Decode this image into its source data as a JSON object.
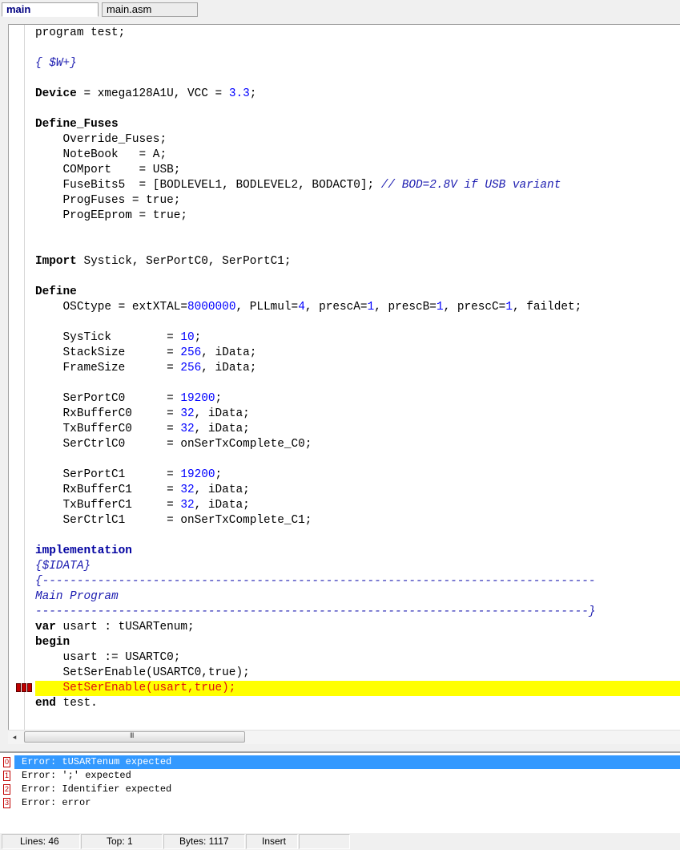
{
  "tabs": [
    {
      "label": "main",
      "active": true
    },
    {
      "label": "main.asm",
      "active": false
    }
  ],
  "code_lines": [
    [
      {
        "t": "program test;"
      }
    ],
    [],
    [
      {
        "t": "{ $W+}",
        "c": "cm"
      }
    ],
    [],
    [
      {
        "t": "Device",
        "c": "kw"
      },
      {
        "t": " = xmega128A1U, VCC = "
      },
      {
        "t": "3.3",
        "c": "num"
      },
      {
        "t": ";"
      }
    ],
    [],
    [
      {
        "t": "Define_Fuses",
        "c": "kw"
      }
    ],
    [
      {
        "t": "    Override_Fuses;"
      }
    ],
    [
      {
        "t": "    NoteBook   = A;"
      }
    ],
    [
      {
        "t": "    COMport    = USB;"
      }
    ],
    [
      {
        "t": "    FuseBits5  = [BODLEVEL1, BODLEVEL2, BODACT0]; "
      },
      {
        "t": "// BOD=2.8V if USB variant",
        "c": "cm"
      }
    ],
    [
      {
        "t": "    ProgFuses = true;"
      }
    ],
    [
      {
        "t": "    ProgEEprom = true;"
      }
    ],
    [],
    [],
    [
      {
        "t": "Import",
        "c": "kw"
      },
      {
        "t": " Systick, SerPortC0, SerPortC1;"
      }
    ],
    [],
    [
      {
        "t": "Define",
        "c": "kw"
      }
    ],
    [
      {
        "t": "    OSCtype = extXTAL="
      },
      {
        "t": "8000000",
        "c": "num"
      },
      {
        "t": ", PLLmul="
      },
      {
        "t": "4",
        "c": "num"
      },
      {
        "t": ", prescA="
      },
      {
        "t": "1",
        "c": "num"
      },
      {
        "t": ", prescB="
      },
      {
        "t": "1",
        "c": "num"
      },
      {
        "t": ", prescC="
      },
      {
        "t": "1",
        "c": "num"
      },
      {
        "t": ", faildet;"
      }
    ],
    [],
    [
      {
        "t": "    SysTick        = "
      },
      {
        "t": "10",
        "c": "num"
      },
      {
        "t": ";"
      }
    ],
    [
      {
        "t": "    StackSize      = "
      },
      {
        "t": "256",
        "c": "num"
      },
      {
        "t": ", iData;"
      }
    ],
    [
      {
        "t": "    FrameSize      = "
      },
      {
        "t": "256",
        "c": "num"
      },
      {
        "t": ", iData;"
      }
    ],
    [],
    [
      {
        "t": "    SerPortC0      = "
      },
      {
        "t": "19200",
        "c": "num"
      },
      {
        "t": ";"
      }
    ],
    [
      {
        "t": "    RxBufferC0     = "
      },
      {
        "t": "32",
        "c": "num"
      },
      {
        "t": ", iData;"
      }
    ],
    [
      {
        "t": "    TxBufferC0     = "
      },
      {
        "t": "32",
        "c": "num"
      },
      {
        "t": ", iData;"
      }
    ],
    [
      {
        "t": "    SerCtrlC0      = onSerTxComplete_C0;"
      }
    ],
    [],
    [
      {
        "t": "    SerPortC1      = "
      },
      {
        "t": "19200",
        "c": "num"
      },
      {
        "t": ";"
      }
    ],
    [
      {
        "t": "    RxBufferC1     = "
      },
      {
        "t": "32",
        "c": "num"
      },
      {
        "t": ", iData;"
      }
    ],
    [
      {
        "t": "    TxBufferC1     = "
      },
      {
        "t": "32",
        "c": "num"
      },
      {
        "t": ", iData;"
      }
    ],
    [
      {
        "t": "    SerCtrlC1      = onSerTxComplete_C1;"
      }
    ],
    [],
    [
      {
        "t": "implementation",
        "c": "kw2"
      }
    ],
    [
      {
        "t": "{$IDATA}",
        "c": "cm"
      }
    ],
    [
      {
        "t": "{--------------------------------------------------------------------------------",
        "c": "cm"
      }
    ],
    [
      {
        "t": "Main Program",
        "c": "cm"
      }
    ],
    [
      {
        "t": "--------------------------------------------------------------------------------}",
        "c": "cm"
      }
    ],
    [
      {
        "t": "var",
        "c": "kw"
      },
      {
        "t": " usart : tUSARTenum;"
      }
    ],
    [
      {
        "t": "begin",
        "c": "kw"
      }
    ],
    [
      {
        "t": "    usart := USARTC0;"
      }
    ],
    [
      {
        "t": "    SetSerEnable(USARTC0,true);"
      }
    ],
    [
      {
        "t": "    SetSerEnable(usart,true);"
      }
    ],
    [
      {
        "t": "end",
        "c": "kw"
      },
      {
        "t": " test."
      }
    ]
  ],
  "error_line_index": 43,
  "errors": [
    {
      "num": "0",
      "text": "Error: tUSARTenum expected",
      "selected": true
    },
    {
      "num": "1",
      "text": "Error: ';' expected",
      "selected": false
    },
    {
      "num": "2",
      "text": "Error: Identifier expected",
      "selected": false
    },
    {
      "num": "3",
      "text": "Error: error",
      "selected": false
    }
  ],
  "scrollbar": {
    "left_arrow": "◂",
    "grip": "III"
  },
  "status": {
    "lines": "Lines: 46",
    "top": "Top: 1",
    "bytes": "Bytes: 1117",
    "mode": "Insert",
    "extra": ""
  }
}
